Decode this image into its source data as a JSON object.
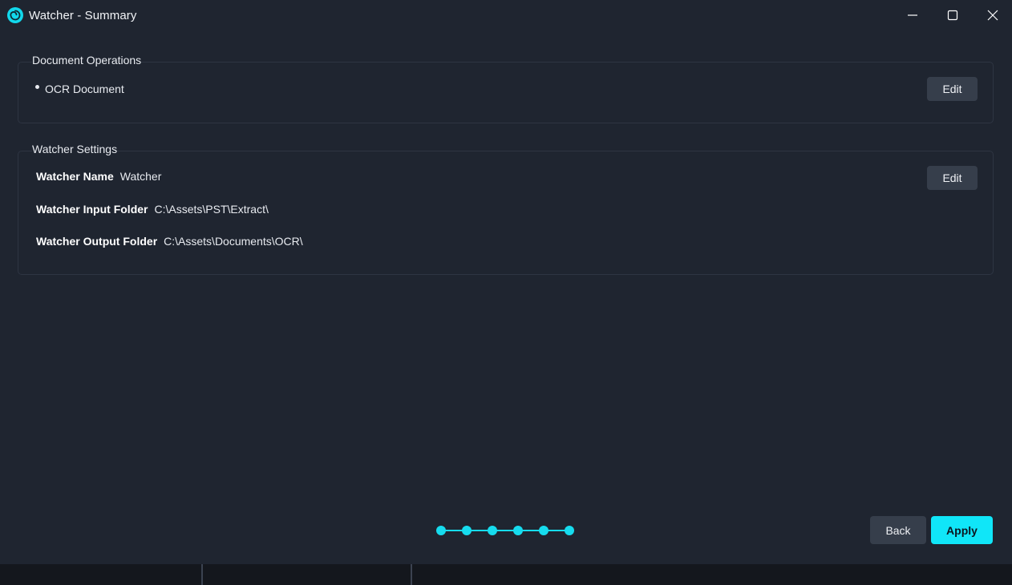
{
  "window": {
    "title": "Watcher - Summary",
    "app_icon": "swirl-logo-icon",
    "controls": {
      "minimize_icon": "minimize-icon",
      "maximize_icon": "maximize-icon",
      "close_icon": "close-icon"
    }
  },
  "document_operations": {
    "title": "Document Operations",
    "items": [
      {
        "label": "OCR Document"
      }
    ],
    "edit_label": "Edit"
  },
  "watcher_settings": {
    "title": "Watcher Settings",
    "edit_label": "Edit",
    "rows": [
      {
        "key": "Watcher Name",
        "value": "Watcher"
      },
      {
        "key": "Watcher Input Folder",
        "value": "C:\\Assets\\PST\\Extract\\"
      },
      {
        "key": "Watcher Output Folder",
        "value": "C:\\Assets\\Documents\\OCR\\"
      }
    ]
  },
  "stepper": {
    "total_steps": 6,
    "completed_steps": 6
  },
  "footer": {
    "back_label": "Back",
    "apply_label": "Apply"
  },
  "colors": {
    "accent": "#10e6f8",
    "background": "#1f2530",
    "button_bg": "#363e4b",
    "border": "#2e3542"
  }
}
